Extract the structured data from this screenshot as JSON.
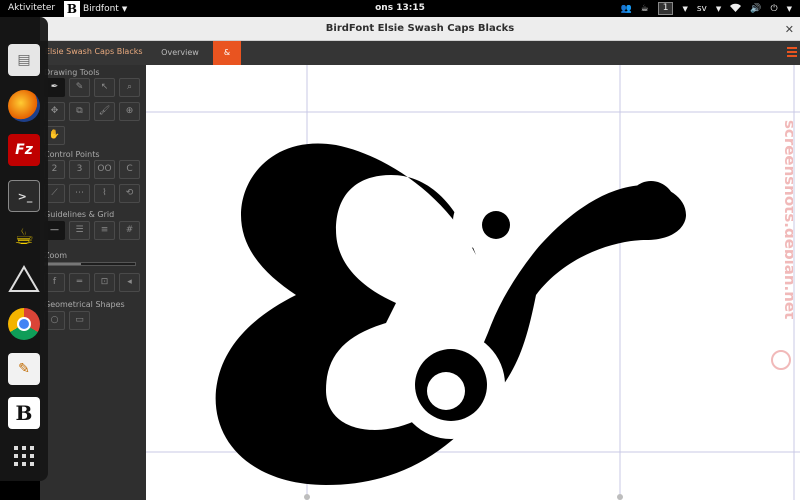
{
  "topbar": {
    "activities": "Aktiviteter",
    "app_menu": "Birdfont",
    "clock": "ons 13:15",
    "workspace": "1",
    "language": "sv"
  },
  "window": {
    "title": "BirdFont Elsie Swash Caps Blacks"
  },
  "tabbar": {
    "font_name": "Elsie Swash Caps Blacks",
    "tabs": [
      {
        "label": "Overview"
      },
      {
        "label": "&"
      }
    ]
  },
  "toolbox": {
    "drawing_tools": "Drawing Tools",
    "control_points": "Control Points",
    "guidelines": "Guidelines & Grid",
    "zoom": "Zoom",
    "zoom_level": 0.4,
    "shapes": "Geometrical Shapes",
    "point_buttons": [
      "2",
      "3",
      "OO",
      "C"
    ],
    "zoom_button": "f"
  },
  "dash": {
    "apps": [
      "files",
      "firefox",
      "filezilla",
      "terminal",
      "teapot",
      "inkscape",
      "chrome",
      "text-editor",
      "birdfont",
      "app-grid"
    ]
  },
  "watermark": "screenshots.debian.net",
  "colors": {
    "accent": "#e95420",
    "panel": "#2f2f2f",
    "tabbar": "#353535",
    "guide": "#c9c9e6"
  }
}
